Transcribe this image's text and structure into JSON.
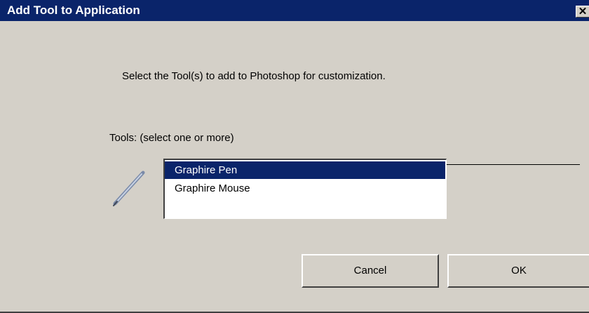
{
  "dialog": {
    "title": "Add Tool to Application",
    "close_glyph": "✕",
    "instruction": "Select the Tool(s) to add to  Photoshop  for customization.",
    "tools_label": "Tools: (select one or more)",
    "tool_icon": "pen-icon",
    "tools": [
      {
        "label": "Graphire Pen",
        "selected": true
      },
      {
        "label": "Graphire Mouse",
        "selected": false
      }
    ],
    "buttons": {
      "cancel_label": "Cancel",
      "ok_label": "OK"
    },
    "colors": {
      "titlebar": "#0a246a",
      "face": "#d4d0c8",
      "selection": "#0a246a"
    }
  }
}
